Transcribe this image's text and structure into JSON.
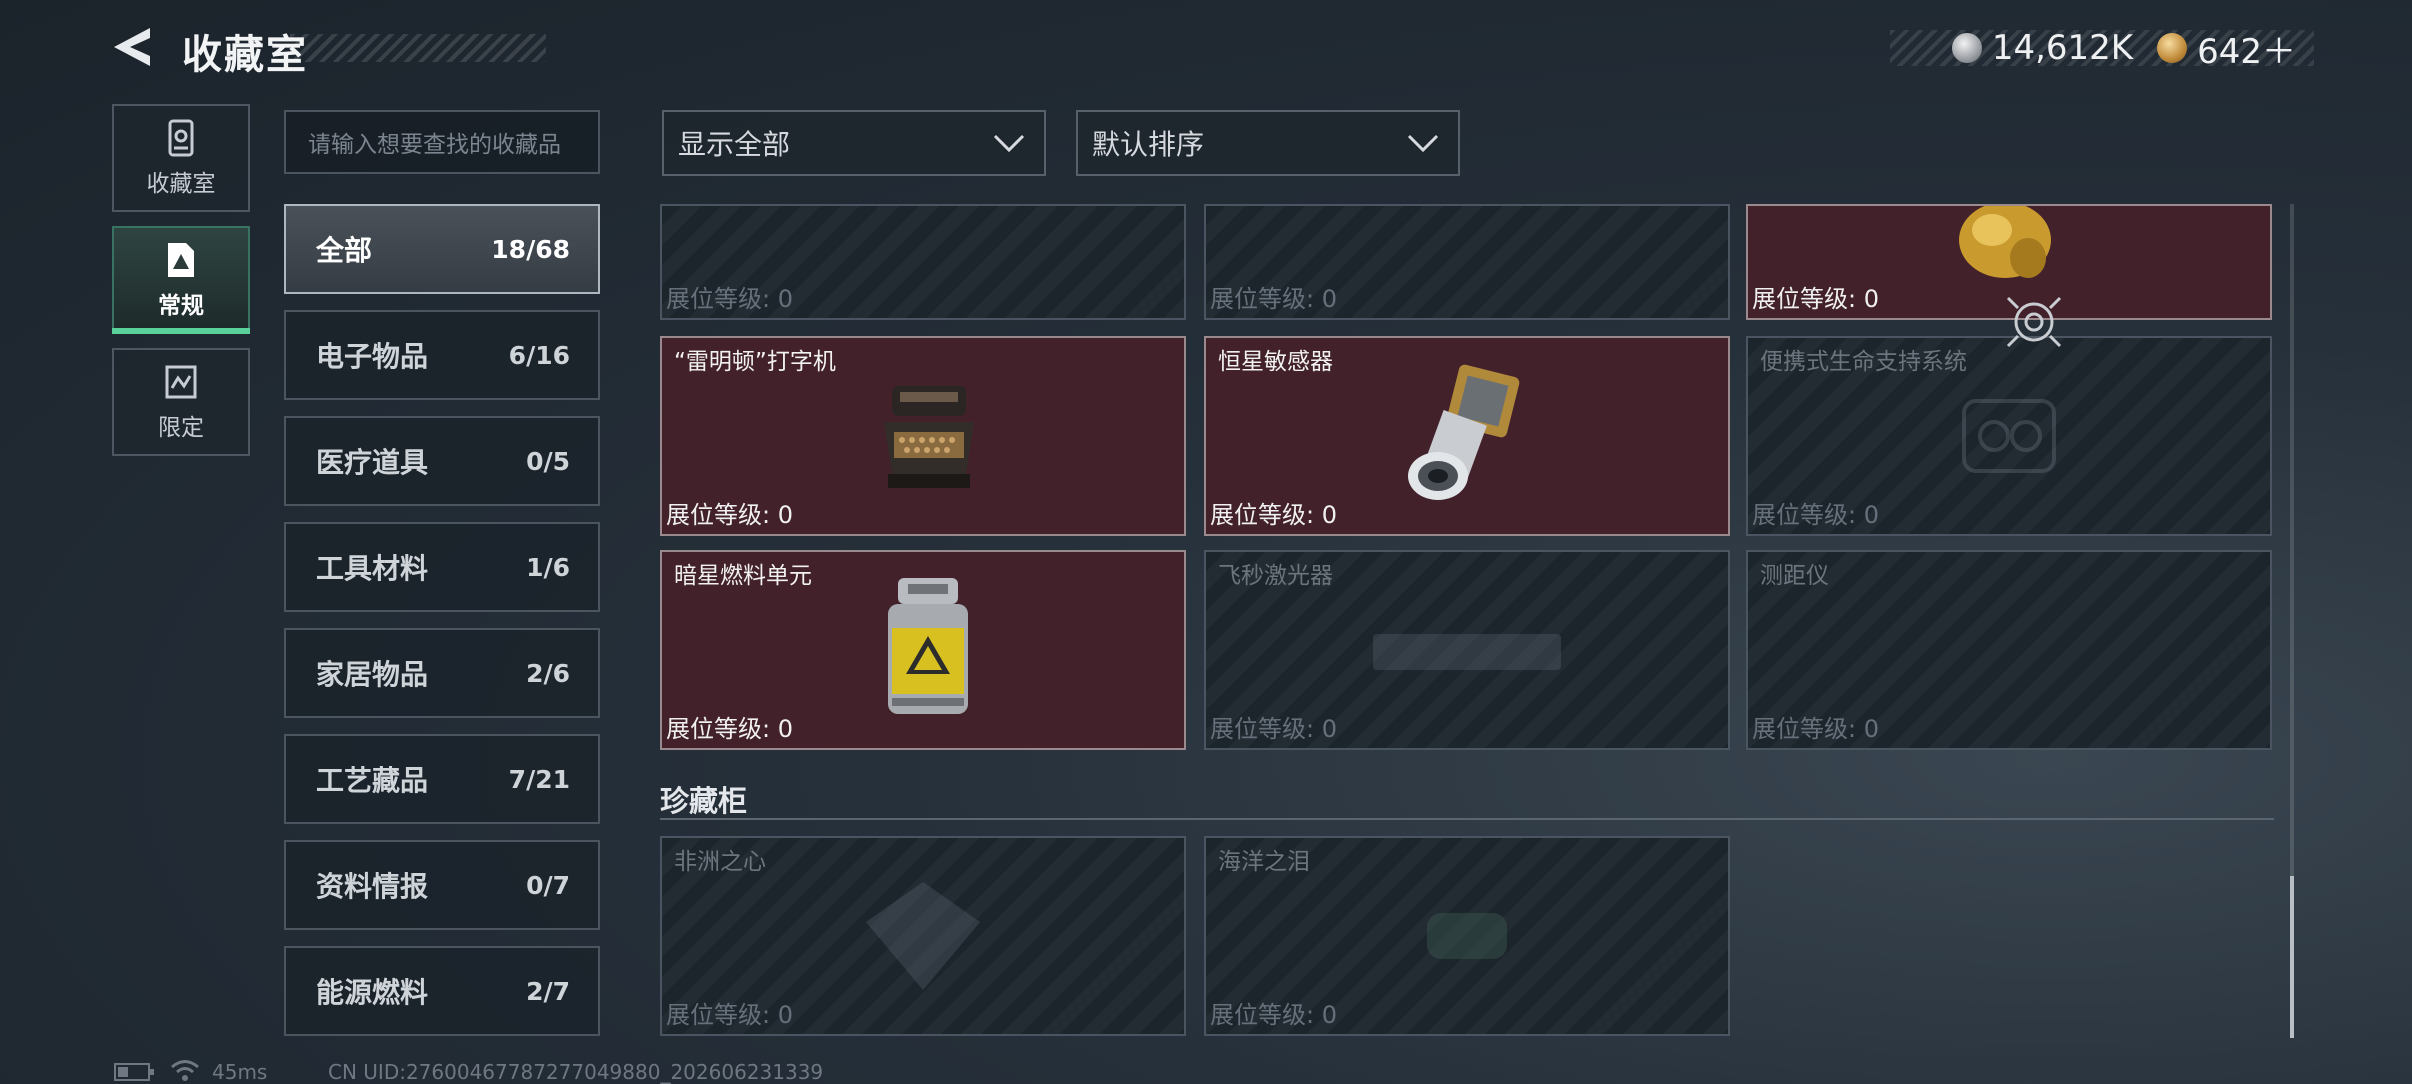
{
  "header": {
    "title": "收藏室"
  },
  "currency": [
    {
      "icon": "silver-coin-icon",
      "value": "14,612K"
    },
    {
      "icon": "gold-coin-icon",
      "value": "642＋"
    }
  ],
  "nav": [
    {
      "label": "收藏室",
      "icon": "collection-room-icon"
    },
    {
      "label": "常规",
      "icon": "regular-icon",
      "active": true
    },
    {
      "label": "限定",
      "icon": "limited-icon"
    }
  ],
  "search": {
    "placeholder": "请输入想要查找的收藏品"
  },
  "categories": [
    {
      "name": "全部",
      "count": "18/68",
      "active": true
    },
    {
      "name": "电子物品",
      "count": "6/16"
    },
    {
      "name": "医疗道具",
      "count": "0/5"
    },
    {
      "name": "工具材料",
      "count": "1/6"
    },
    {
      "name": "家居物品",
      "count": "2/6"
    },
    {
      "name": "工艺藏品",
      "count": "7/21"
    },
    {
      "name": "资料情报",
      "count": "0/7"
    },
    {
      "name": "能源燃料",
      "count": "2/7"
    }
  ],
  "filters": {
    "display": "显示全部",
    "sort": "默认排序"
  },
  "cards": [
    {
      "name": "",
      "level": "展位等级: 0",
      "owned": false
    },
    {
      "name": "",
      "level": "展位等级: 0",
      "owned": false
    },
    {
      "name": "",
      "level": "展位等级: 0",
      "owned": true
    },
    {
      "name": "“雷明顿”打字机",
      "level": "展位等级: 0",
      "owned": true,
      "icon": "typewriter-icon"
    },
    {
      "name": "恒星敏感器",
      "level": "展位等级: 0",
      "owned": true,
      "icon": "star-sensor-icon"
    },
    {
      "name": "便携式生命支持系统",
      "level": "展位等级: 0",
      "owned": false
    },
    {
      "name": "暗星燃料单元",
      "level": "展位等级: 0",
      "owned": true,
      "icon": "fuel-canister-icon"
    },
    {
      "name": "飞秒激光器",
      "level": "展位等级: 0",
      "owned": false
    },
    {
      "name": "测距仪",
      "level": "展位等级: 0",
      "owned": false
    }
  ],
  "treasure": {
    "title": "珍藏柜",
    "cards": [
      {
        "name": "非洲之心",
        "level": "展位等级: 0"
      },
      {
        "name": "海洋之泪",
        "level": "展位等级: 0"
      }
    ]
  },
  "status": {
    "ping": "45ms",
    "uid": "CN UID:27600467787277049880_202606231339"
  }
}
